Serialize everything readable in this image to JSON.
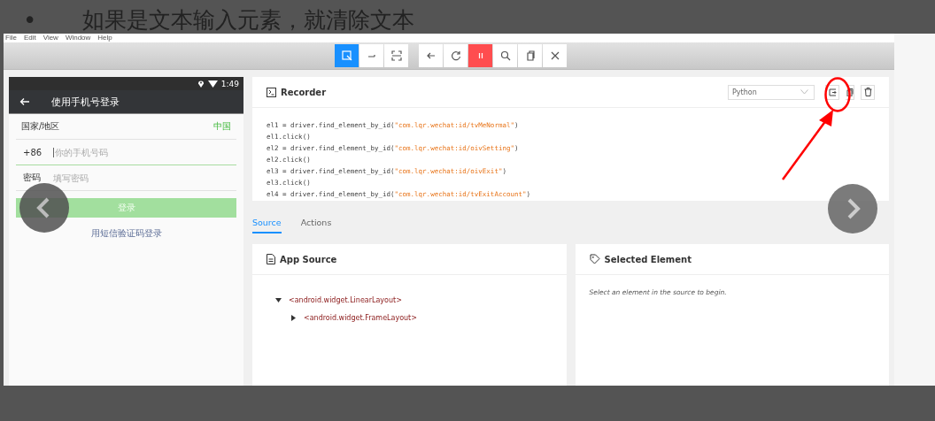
{
  "caption": {
    "bullet": "•",
    "text": "如果是文本输入元素，就清除文本"
  },
  "menu": [
    "File",
    "Edit",
    "View",
    "Window",
    "Help"
  ],
  "toolbar": {
    "groups": [
      [
        {
          "kind": "select",
          "selected": true
        },
        {
          "kind": "swipe",
          "selected": false
        },
        {
          "kind": "tap-area",
          "selected": false
        }
      ],
      [
        {
          "kind": "back",
          "selected": false
        },
        {
          "kind": "refresh",
          "selected": false
        },
        {
          "kind": "pause",
          "selected": true
        },
        {
          "kind": "search",
          "selected": false
        },
        {
          "kind": "copy",
          "selected": false
        },
        {
          "kind": "close",
          "selected": false
        }
      ]
    ]
  },
  "phone": {
    "time": "1:49",
    "title": "使用手机号登录",
    "region_label": "国家/地区",
    "region_value": "中国",
    "country_code": "+86",
    "phone_placeholder": "你的手机号码",
    "password_label": "密码",
    "password_placeholder": "填写密码",
    "login_button": "登录",
    "sms_link": "用短信验证码登录"
  },
  "recorder": {
    "title": "Recorder",
    "language": "Python",
    "lines": [
      {
        "prefix": "el1 = driver.find_element_by_id(",
        "string": "\"com.lqr.wechat:id/tvMeNormal\"",
        "suffix": ")"
      },
      {
        "prefix": "el1.click()"
      },
      {
        "prefix": "el2 = driver.find_element_by_id(",
        "string": "\"com.lqr.wechat:id/oivSetting\"",
        "suffix": ")"
      },
      {
        "prefix": "el2.click()"
      },
      {
        "prefix": "el3 = driver.find_element_by_id(",
        "string": "\"com.lqr.wechat:id/oivExit\"",
        "suffix": ")"
      },
      {
        "prefix": "el3.click()"
      },
      {
        "prefix": "el4 = driver.find_element_by_id(",
        "string": "\"com.lqr.wechat:id/tvExitAccount\"",
        "suffix": ")"
      }
    ]
  },
  "tabs": [
    {
      "label": "Source",
      "selected": true
    },
    {
      "label": "Actions",
      "selected": false
    }
  ],
  "source": {
    "title": "App Source",
    "tree": [
      {
        "label": "<android.widget.LinearLayout>",
        "expanded": true,
        "children": [
          {
            "label": "<android.widget.FrameLayout>",
            "expanded": false
          }
        ]
      }
    ]
  },
  "selected_element": {
    "title": "Selected Element",
    "hint": "Select an element in the source to begin."
  }
}
